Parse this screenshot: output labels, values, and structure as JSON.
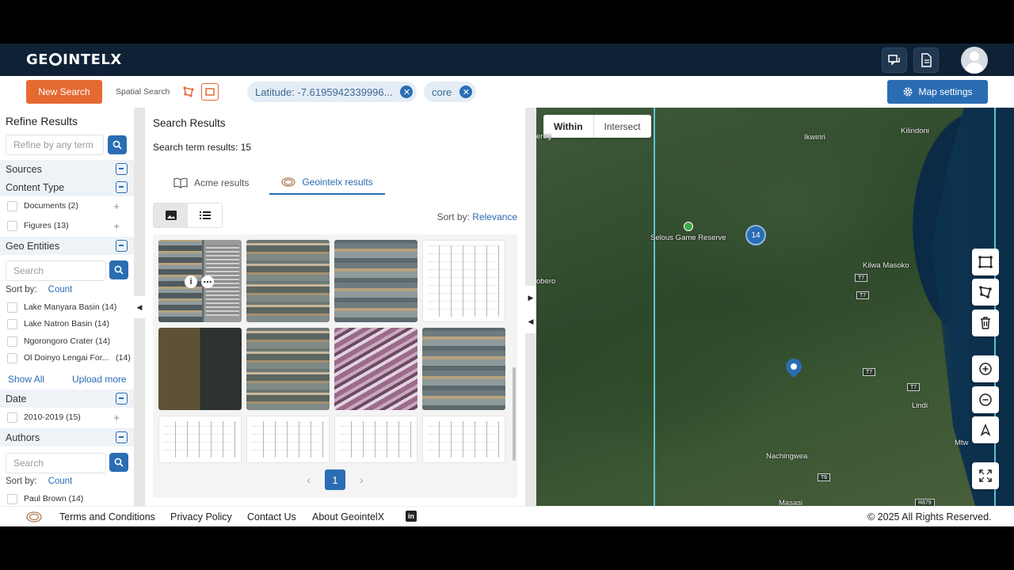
{
  "header": {
    "logo_text_1": "GE",
    "logo_text_2": "INTELX",
    "icons": [
      "chat-icon",
      "document-icon",
      "user-avatar-icon"
    ]
  },
  "searchbar": {
    "new_search": "New Search",
    "spatial_label": "Spatial Search",
    "chips": [
      {
        "label": "Latitude: -7.6195942339996..."
      },
      {
        "label": "core"
      }
    ],
    "map_settings": "Map settings"
  },
  "sidebar": {
    "title": "Refine Results",
    "refine_placeholder": "Refine by any term",
    "sources": "Sources",
    "content_type": "Content Type",
    "content_items": [
      {
        "label": "Documents (2)"
      },
      {
        "label": "Figures (13)"
      }
    ],
    "geo_entities": "Geo Entities",
    "geo_search_placeholder": "Search",
    "sort_by_label": "Sort by:",
    "sort_by_value": "Count",
    "geo_items": [
      {
        "label": "Lake Manyara Basin",
        "count": "(14)"
      },
      {
        "label": "Lake Natron Basin",
        "count": "(14)"
      },
      {
        "label": "Ngorongoro Crater",
        "count": "(14)"
      },
      {
        "label": "Ol Doinyo Lengai For...",
        "count": "(14)"
      }
    ],
    "show_all": "Show All",
    "upload_more": "Upload more",
    "date": "Date",
    "date_items": [
      {
        "label": "2010-2019 (15)"
      }
    ],
    "authors": "Authors",
    "authors_search_placeholder": "Search",
    "author_sort_label": "Sort by:",
    "author_sort_value": "Count",
    "author_items": [
      {
        "label": "Paul Brown",
        "count": "(14)"
      }
    ]
  },
  "results": {
    "title": "Search Results",
    "count_label": "Search term results:",
    "count_value": "15",
    "tabs": [
      {
        "label": "Acme results"
      },
      {
        "label": "Geointelx results"
      }
    ],
    "sort_label": "Sort by:",
    "sort_value": "Relevance",
    "page": "1"
  },
  "map": {
    "within": "Within",
    "intersect": "Intersect",
    "cluster_count": "14",
    "labels": [
      "Kilindoni",
      "Ikwiriri",
      "Selous Game Reserve",
      "Kilwa Masoko",
      "obero",
      "Lindi",
      "Nachingwea",
      "Masasi",
      "Mtw",
      "ereg"
    ],
    "roads": [
      "T7",
      "T7",
      "T7",
      "T7",
      "T6",
      "R879"
    ]
  },
  "footer": {
    "terms": "Terms and Conditions",
    "privacy": "Privacy Policy",
    "contact": "Contact Us",
    "about": "About GeointelX",
    "copyright": "© 2025 All Rights Reserved."
  },
  "colors": {
    "navbar": "#0f2235",
    "accent": "#2a6db3",
    "new_search": "#e56a32"
  }
}
